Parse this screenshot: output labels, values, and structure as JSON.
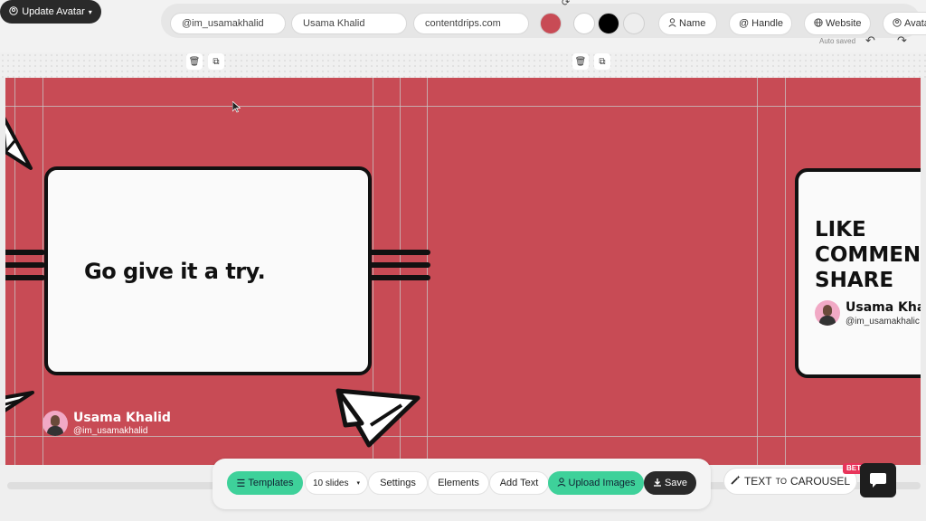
{
  "toolbar": {
    "update_avatar_label": "Update Avatar",
    "handle_value": "@im_usamakhalid",
    "name_value": "Usama Khalid",
    "website_value": "contentdrips.com",
    "colors": [
      "#c84b55",
      "#ffffff",
      "#000000",
      "#eeeeee"
    ],
    "name_label": "Name",
    "handle_label": "Handle",
    "website_label": "Website",
    "avatar_label": "Avata",
    "autosaved": "Auto saved"
  },
  "slides": {
    "slide1": {
      "card_text": "Go give it a try.",
      "author_name": "Usama Khalid",
      "author_handle": "@im_usamakhalid"
    },
    "slide3": {
      "card_text": "LIKE\nCOMMEN\nSHARE",
      "author_name": "Usama Kha",
      "author_handle": "@im_usamakhalic"
    },
    "background_color": "#c84b55"
  },
  "bottombar": {
    "templates": "Templates",
    "slides_count": "10 slides",
    "settings": "Settings",
    "elements": "Elements",
    "add_text": "Add Text",
    "upload_images": "Upload Images",
    "save": "Save"
  },
  "text_to_carousel": {
    "label_main": "TEXT",
    "label_small": "TO",
    "label_tail": "CAROUSEL",
    "badge": "BET"
  }
}
